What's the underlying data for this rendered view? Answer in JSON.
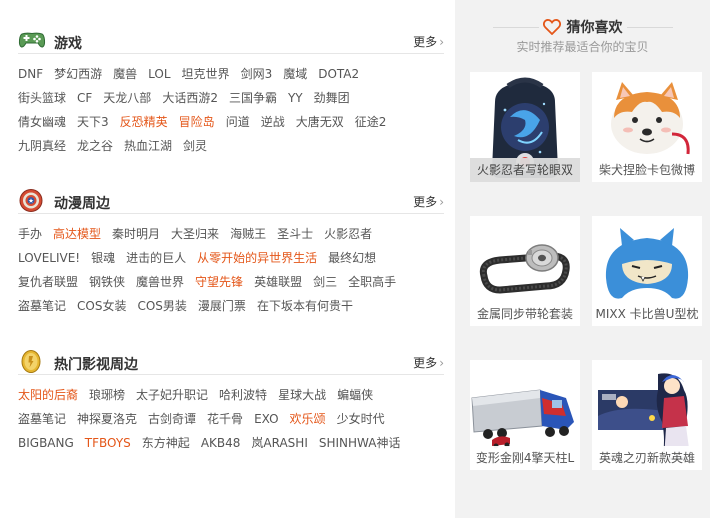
{
  "sections": [
    {
      "title": "游戏",
      "more": "更多",
      "icon": "gamepad-icon",
      "rows": [
        [
          {
            "t": "DNF"
          },
          {
            "t": "梦幻西游"
          },
          {
            "t": "魔兽"
          },
          {
            "t": "LOL"
          },
          {
            "t": "坦克世界"
          },
          {
            "t": "剑网3"
          },
          {
            "t": "魔域"
          },
          {
            "t": "DOTA2"
          }
        ],
        [
          {
            "t": "街头篮球"
          },
          {
            "t": "CF"
          },
          {
            "t": "天龙八部"
          },
          {
            "t": "大话西游2"
          },
          {
            "t": "三国争霸"
          },
          {
            "t": "YY"
          },
          {
            "t": "劲舞团"
          }
        ],
        [
          {
            "t": "倩女幽魂"
          },
          {
            "t": "天下3"
          },
          {
            "t": "反恐精英",
            "hl": true
          },
          {
            "t": "冒险岛",
            "hl": true
          },
          {
            "t": "问道"
          },
          {
            "t": "逆战"
          },
          {
            "t": "大唐无双"
          },
          {
            "t": "征途2"
          }
        ],
        [
          {
            "t": "九阴真经"
          },
          {
            "t": "龙之谷"
          },
          {
            "t": "热血江湖"
          },
          {
            "t": "剑灵"
          }
        ]
      ]
    },
    {
      "title": "动漫周边",
      "more": "更多",
      "icon": "shield-icon",
      "rows": [
        [
          {
            "t": "手办"
          },
          {
            "t": "高达模型",
            "hl": true
          },
          {
            "t": "秦时明月"
          },
          {
            "t": "大圣归来"
          },
          {
            "t": "海贼王"
          },
          {
            "t": "圣斗士"
          },
          {
            "t": "火影忍者"
          }
        ],
        [
          {
            "t": "LOVELIVE!"
          },
          {
            "t": "银魂"
          },
          {
            "t": "进击的巨人"
          },
          {
            "t": "从零开始的异世界生活",
            "hl": true
          },
          {
            "t": "最终幻想"
          }
        ],
        [
          {
            "t": "复仇者联盟"
          },
          {
            "t": "钢铁侠"
          },
          {
            "t": "魔兽世界"
          },
          {
            "t": "守望先锋",
            "hl": true
          },
          {
            "t": "英雄联盟"
          },
          {
            "t": "剑三"
          },
          {
            "t": "全职高手"
          }
        ],
        [
          {
            "t": "盗墓笔记"
          },
          {
            "t": "COS女装"
          },
          {
            "t": "COS男装"
          },
          {
            "t": "漫展门票"
          },
          {
            "t": "在下坂本有何贵干"
          }
        ]
      ]
    },
    {
      "title": "热门影视周边",
      "more": "更多",
      "icon": "coin-icon",
      "rows": [
        [
          {
            "t": "太阳的后裔",
            "hl": true
          },
          {
            "t": "琅琊榜"
          },
          {
            "t": "太子妃升职记"
          },
          {
            "t": "哈利波特"
          },
          {
            "t": "星球大战"
          },
          {
            "t": "蝙蝠侠"
          }
        ],
        [
          {
            "t": "盗墓笔记"
          },
          {
            "t": "神探夏洛克"
          },
          {
            "t": "古剑奇谭"
          },
          {
            "t": "花千骨"
          },
          {
            "t": "EXO"
          },
          {
            "t": "欢乐颂",
            "hl": true
          },
          {
            "t": "少女时代"
          }
        ],
        [
          {
            "t": "BIGBANG"
          },
          {
            "t": "TFBOYS",
            "hl": true
          },
          {
            "t": "东方神起"
          },
          {
            "t": "AKB48"
          },
          {
            "t": "岚ARASHI"
          },
          {
            "t": "SHINHWA神话"
          }
        ]
      ]
    }
  ],
  "guess": {
    "title": "猜你喜欢",
    "subtitle": "实时推荐最适合你的宝贝",
    "icon": "heart-icon",
    "accent": "#e4571a",
    "items": [
      {
        "caption": "火影忍者写轮眼双",
        "image": "backpack-image"
      },
      {
        "caption": "柴犬捏脸卡包微博",
        "image": "shiba-card-holder-image"
      },
      {
        "caption": "金属同步带轮套装",
        "image": "timing-belt-pulley-image"
      },
      {
        "caption": "MIXX 卡比兽U型枕",
        "image": "snorlax-pillow-image"
      },
      {
        "caption": "变形金刚4擎天柱L",
        "image": "truck-toy-image"
      },
      {
        "caption": "英魂之刃新款英雄",
        "image": "game-heroine-image"
      }
    ]
  },
  "colors": {
    "highlight": "#e4571a",
    "sidebar_bg": "#f2f2f2",
    "text": "#555555"
  }
}
